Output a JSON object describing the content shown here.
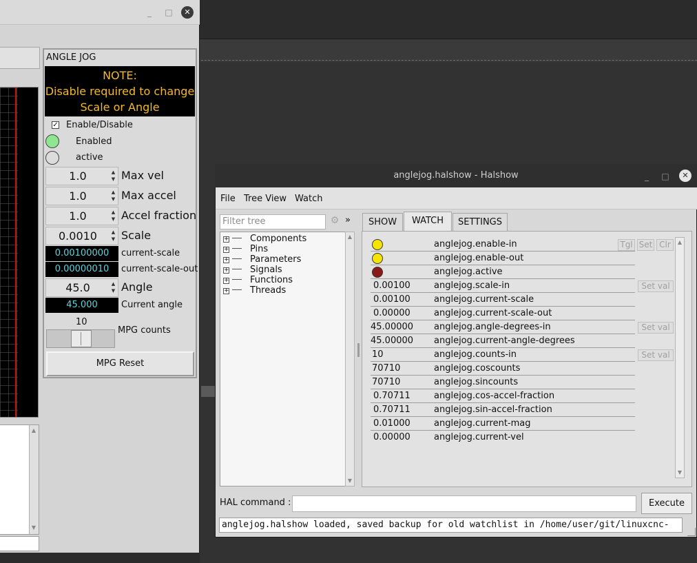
{
  "pyvcp_window": {
    "title_buttons": {
      "minimize": "_",
      "maximize": "□",
      "close": "✕"
    },
    "panel": {
      "title": "ANGLE JOG",
      "note_lines": [
        "NOTE:",
        "Disable required to change",
        "Scale or Angle"
      ],
      "enable_checkbox": {
        "label": "Enable/Disable",
        "mark": "✓"
      },
      "leds": [
        {
          "label": "Enabled",
          "color": "#8ee68e"
        },
        {
          "label": "active",
          "color": "#dcdcdc"
        }
      ],
      "max_vel": {
        "value": "1.0",
        "label": "Max vel"
      },
      "max_accel": {
        "value": "1.0",
        "label": "Max accel"
      },
      "accel_fraction": {
        "value": "1.0",
        "label": "Accel fraction"
      },
      "scale": {
        "value": "0.0010",
        "label": "Scale"
      },
      "current_scale": {
        "value": "0.00100000",
        "label": "current-scale"
      },
      "current_scale_out": {
        "value": "0.00000010",
        "label": "current-scale-out"
      },
      "angle": {
        "value": "45.0",
        "label": "Angle"
      },
      "current_angle": {
        "value": "45.000",
        "label": "Current angle"
      },
      "mpg": {
        "value": "10",
        "label": "MPG counts"
      },
      "mpg_reset_label": "MPG Reset"
    }
  },
  "halshow_window": {
    "title": "anglejog.halshow - Halshow",
    "title_buttons": {
      "minimize": "_",
      "maximize": "□",
      "close": "✕"
    },
    "menu": [
      "File",
      "Tree View",
      "Watch"
    ],
    "filter_placeholder": "Filter tree",
    "gear_icon": "⚙",
    "more_label": "»",
    "tree": [
      "Components",
      "Pins",
      "Parameters",
      "Signals",
      "Functions",
      "Threads"
    ],
    "tree_expander": "+",
    "tabs": [
      "SHOW",
      "WATCH",
      "SETTINGS"
    ],
    "active_tab": "WATCH",
    "row_buttons": {
      "toggle": "Tgl",
      "set": "Set",
      "clear": "Clr",
      "set_val": "Set val"
    },
    "watch_rows": [
      {
        "type": "led",
        "color": "#f5e400",
        "name": "anglejog.enable-in"
      },
      {
        "type": "led",
        "color": "#f5e400",
        "name": "anglejog.enable-out"
      },
      {
        "type": "led",
        "color": "#8a1a1a",
        "name": "anglejog.active"
      },
      {
        "type": "value",
        "value": "0.00100",
        "name": "anglejog.scale-in"
      },
      {
        "type": "value",
        "value": "0.00100",
        "name": "anglejog.current-scale"
      },
      {
        "type": "value",
        "value": "0.00000",
        "name": "anglejog.current-scale-out"
      },
      {
        "type": "value",
        "value": "45.00000",
        "name": "anglejog.angle-degrees-in"
      },
      {
        "type": "value",
        "value": "45.00000",
        "name": "anglejog.current-angle-degrees"
      },
      {
        "type": "value",
        "value": "10",
        "name": "anglejog.counts-in"
      },
      {
        "type": "value",
        "value": "70710",
        "name": "anglejog.coscounts"
      },
      {
        "type": "value",
        "value": "70710",
        "name": "anglejog.sincounts"
      },
      {
        "type": "value",
        "value": "0.70711",
        "name": "anglejog.cos-accel-fraction"
      },
      {
        "type": "value",
        "value": "0.70711",
        "name": "anglejog.sin-accel-fraction"
      },
      {
        "type": "value",
        "value": "0.01000",
        "name": "anglejog.current-mag"
      },
      {
        "type": "value",
        "value": "0.00000",
        "name": "anglejog.current-vel"
      }
    ],
    "hal_command_label": "HAL command :",
    "hal_command_value": "",
    "execute_label": "Execute",
    "status_text": "anglejog.halshow loaded, saved backup for old watchlist in /home/user/git/linuxcnc-"
  }
}
